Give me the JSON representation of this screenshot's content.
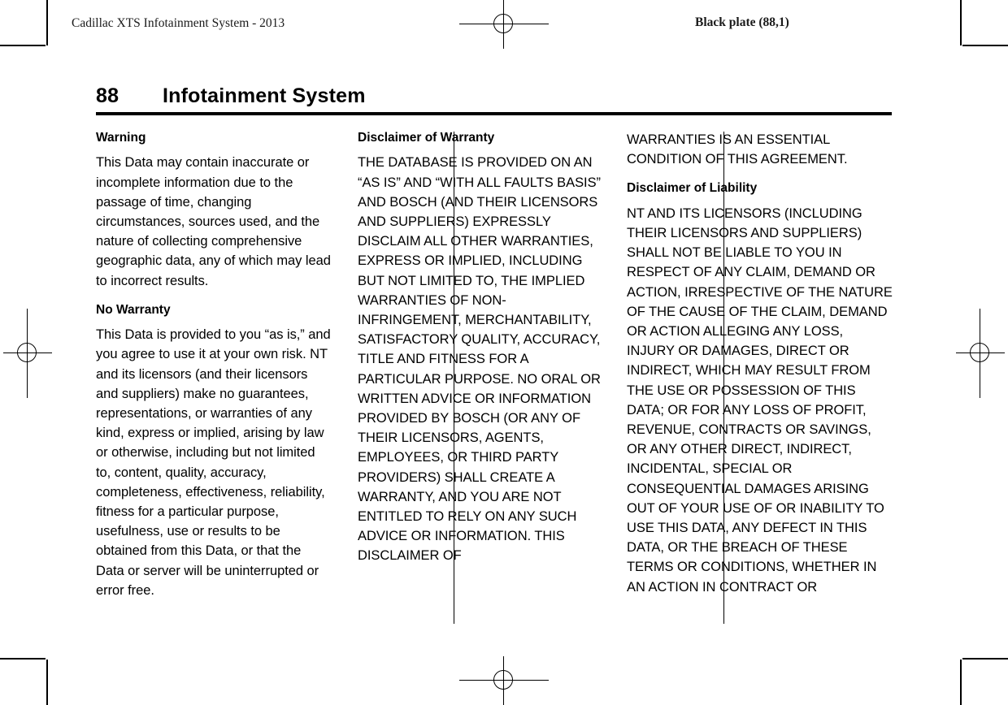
{
  "running_head": {
    "left": "Cadillac XTS Infotainment System - 2013",
    "right": "Black plate (88,1)"
  },
  "page_header": {
    "folio": "88",
    "title": "Infotainment System"
  },
  "columns": [
    {
      "id": "column-1",
      "blocks": [
        {
          "type": "heading",
          "text": "Warning"
        },
        {
          "type": "paragraph",
          "text": "This Data may contain inaccurate or incomplete information due to the passage of time, changing circumstances, sources used, and the nature of collecting comprehensive geographic data, any of which may lead to incorrect results."
        },
        {
          "type": "heading",
          "text": "No Warranty"
        },
        {
          "type": "paragraph",
          "text": "This Data is provided to you “as is,” and you agree to use it at your own risk. NT and its licensors (and their licensors and suppliers) make no guarantees, representations, or warranties of any kind, express or implied, arising by law or otherwise, including but not limited to, content, quality, accuracy, completeness, effectiveness, reliability, fitness for a particular purpose, usefulness, use or results to be obtained from this Data, or that the Data or server will be uninterrupted or error free."
        }
      ]
    },
    {
      "id": "column-2",
      "blocks": [
        {
          "type": "heading",
          "text": "Disclaimer of Warranty"
        },
        {
          "type": "paragraph",
          "text": "THE DATABASE IS PROVIDED ON AN “AS IS” AND “WITH ALL FAULTS BASIS” AND BOSCH (AND THEIR LICENSORS AND SUPPLIERS) EXPRESSLY DISCLAIM ALL OTHER WARRANTIES, EXPRESS OR IMPLIED, INCLUDING BUT NOT LIMITED TO, THE IMPLIED WARRANTIES OF NON-INFRINGEMENT, MERCHANTABILITY, SATISFACTORY QUALITY, ACCURACY, TITLE AND FITNESS FOR A PARTICULAR PURPOSE. NO ORAL OR WRITTEN ADVICE OR INFORMATION PROVIDED BY BOSCH (OR ANY OF THEIR LICENSORS, AGENTS, EMPLOYEES, OR THIRD PARTY PROVIDERS) SHALL CREATE A WARRANTY, AND YOU ARE NOT ENTITLED TO RELY ON ANY SUCH ADVICE OR INFORMATION. THIS DISCLAIMER OF"
        }
      ]
    },
    {
      "id": "column-3",
      "blocks": [
        {
          "type": "paragraph",
          "text": "WARRANTIES IS AN ESSENTIAL CONDITION OF THIS AGREEMENT."
        },
        {
          "type": "heading",
          "text": "Disclaimer of Liability"
        },
        {
          "type": "paragraph",
          "text": "NT AND ITS LICENSORS (INCLUDING THEIR LICENSORS AND SUPPLIERS) SHALL NOT BE LIABLE TO YOU IN RESPECT OF ANY CLAIM, DEMAND OR ACTION, IRRESPECTIVE OF THE NATURE OF THE CAUSE OF THE CLAIM, DEMAND OR ACTION ALLEGING ANY LOSS, INJURY OR DAMAGES, DIRECT OR INDIRECT, WHICH MAY RESULT FROM THE USE OR POSSESSION OF THIS DATA; OR FOR ANY LOSS OF PROFIT, REVENUE, CONTRACTS OR SAVINGS, OR ANY OTHER DIRECT, INDIRECT, INCIDENTAL, SPECIAL OR CONSEQUENTIAL DAMAGES ARISING OUT OF YOUR USE OF OR INABILITY TO USE THIS DATA, ANY DEFECT IN THIS DATA, OR THE BREACH OF THESE TERMS OR CONDITIONS, WHETHER IN AN ACTION IN CONTRACT OR"
        }
      ]
    }
  ]
}
